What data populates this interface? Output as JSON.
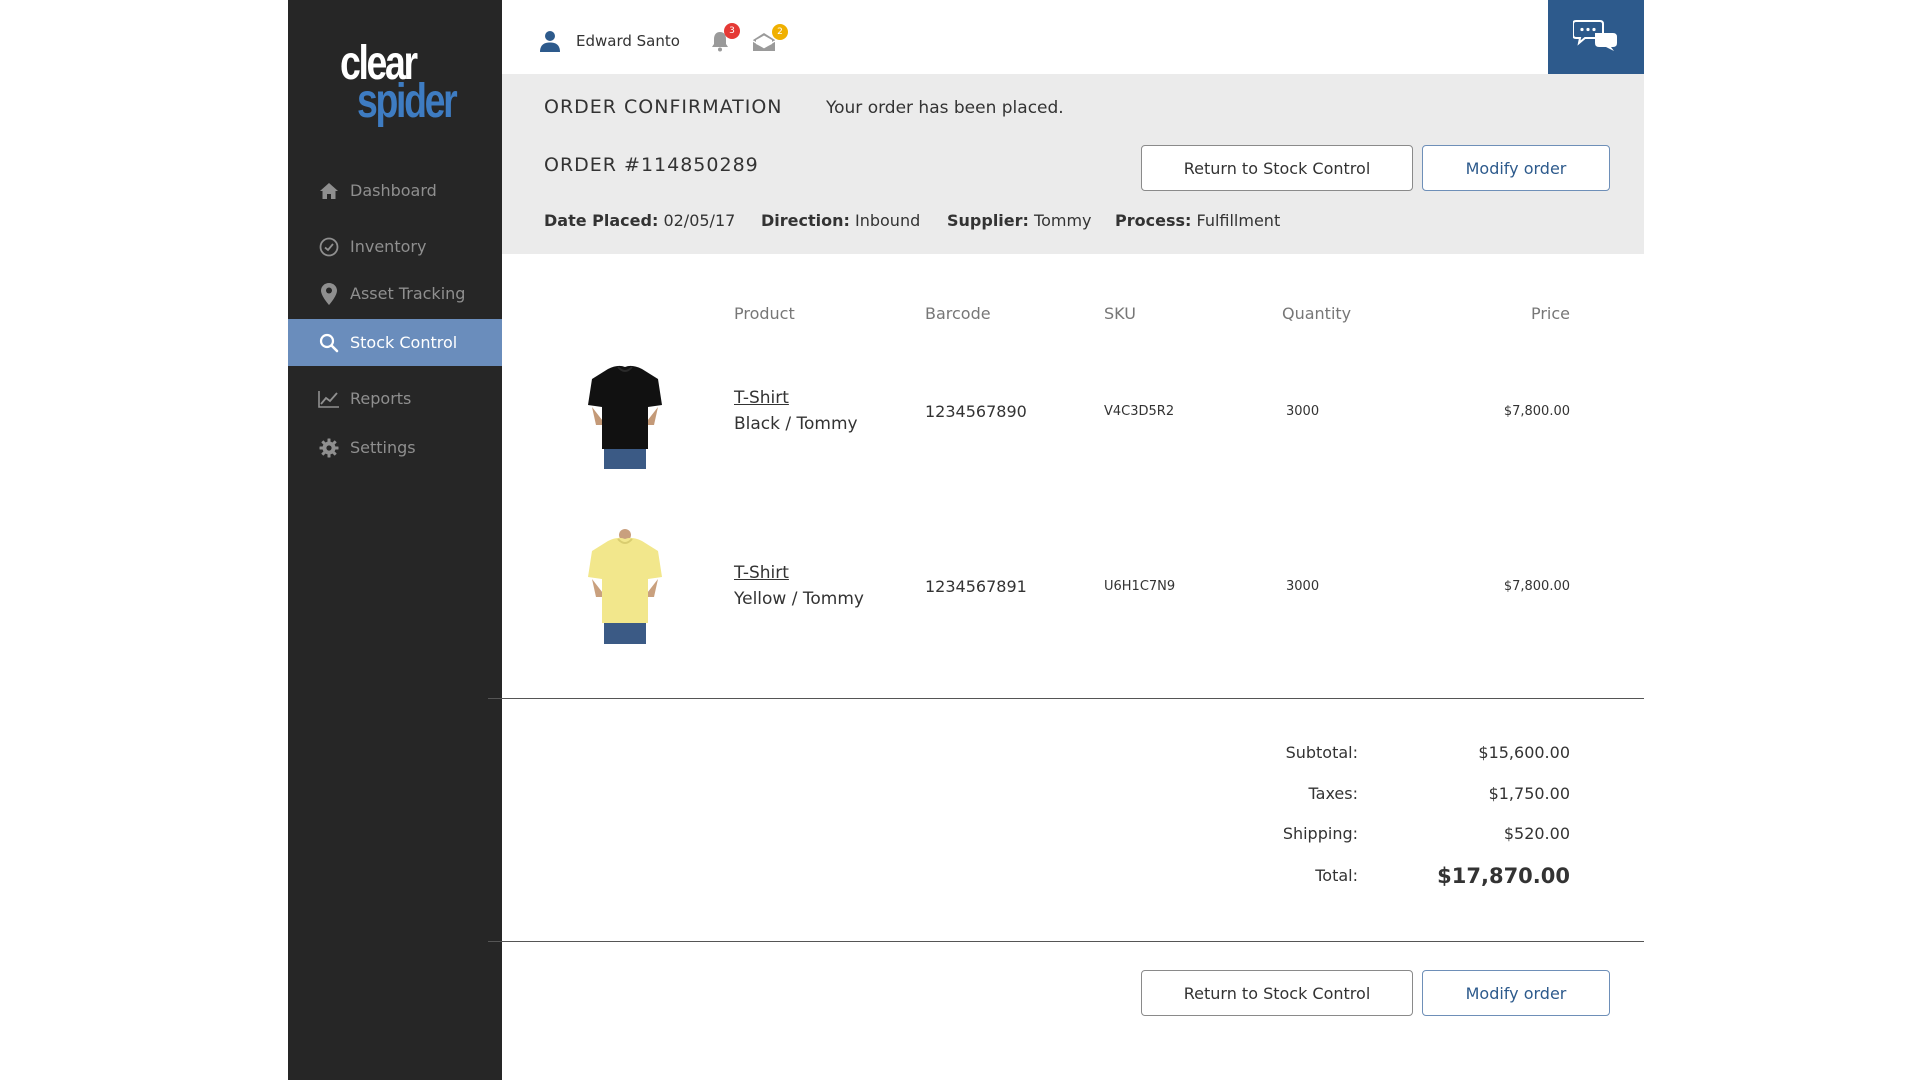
{
  "brand": {
    "line1": "clear",
    "line2": "spider"
  },
  "nav": [
    {
      "label": "Dashboard",
      "icon": "home-icon"
    },
    {
      "label": "Inventory",
      "icon": "check-circle-icon"
    },
    {
      "label": "Asset Tracking",
      "icon": "map-pin-icon"
    },
    {
      "label": "Stock Control",
      "icon": "search-icon",
      "active": true
    },
    {
      "label": "Reports",
      "icon": "line-chart-icon"
    },
    {
      "label": "Settings",
      "icon": "gear-icon"
    }
  ],
  "header": {
    "user_name": "Edward Santo",
    "notifications_count": "3",
    "messages_count": "2"
  },
  "order": {
    "confirmation_title": "ORDER CONFIRMATION",
    "confirmation_message": "Your order has been placed.",
    "number": "ORDER #114850289",
    "date_label": "Date Placed:",
    "date_value": "02/05/17",
    "direction_label": "Direction:",
    "direction_value": "Inbound",
    "supplier_label": "Supplier:",
    "supplier_value": "Tommy",
    "process_label": "Process:",
    "process_value": "Fulfillment"
  },
  "actions": {
    "return_label": "Return to Stock Control",
    "modify_label": "Modify order"
  },
  "table": {
    "columns": [
      "Product",
      "Barcode",
      "SKU",
      "Quantity",
      "Price"
    ],
    "rows": [
      {
        "name": "T-Shirt",
        "variant": "Black / Tommy",
        "barcode": "1234567890",
        "sku": "V4C3D5R2",
        "quantity": "3000",
        "price": "$7,800.00",
        "shirt_color": "#111111"
      },
      {
        "name": "T-Shirt",
        "variant": "Yellow / Tommy",
        "barcode": "1234567891",
        "sku": "U6H1C7N9",
        "quantity": "3000",
        "price": "$7,800.00",
        "shirt_color": "#f2e78c"
      }
    ]
  },
  "totals": {
    "subtotal_label": "Subtotal:",
    "subtotal": "$15,600.00",
    "taxes_label": "Taxes:",
    "taxes": "$1,750.00",
    "shipping_label": "Shipping:",
    "shipping": "$520.00",
    "total_label": "Total:",
    "total": "$17,870.00"
  },
  "colors": {
    "sidebar_bg": "#262626",
    "active_nav": "#6a8dbc",
    "brand_blue": "#2d5a8c",
    "panel_bg": "#ebebeb"
  }
}
